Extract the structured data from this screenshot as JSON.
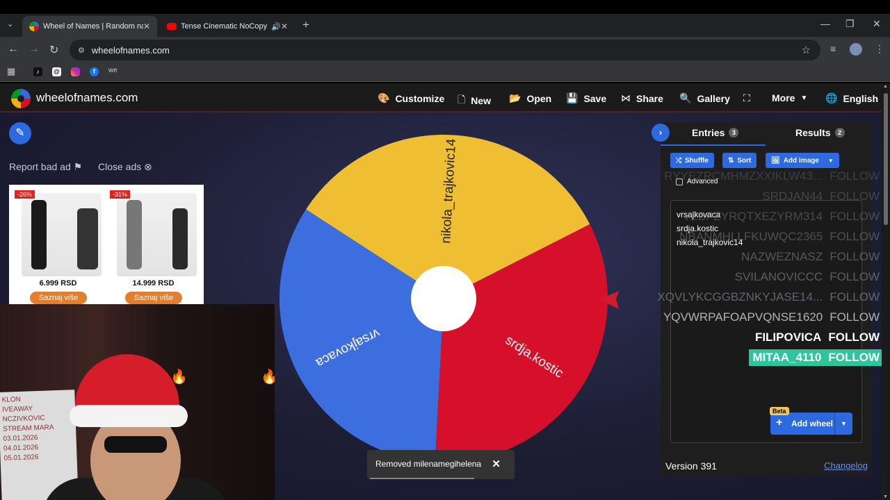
{
  "browser": {
    "tabs": [
      {
        "title": "Wheel of Names | Random nam",
        "active": true
      },
      {
        "title": "Tense Cinematic NoCopyrig",
        "active": false
      }
    ],
    "url": "wheelofnames.com",
    "bookmark_text": "we"
  },
  "site": {
    "name": "wheelofnames.com",
    "nav": {
      "customize": "Customize",
      "new": "New",
      "open": "Open",
      "save": "Save",
      "share": "Share",
      "gallery": "Gallery",
      "more": "More",
      "language": "English"
    }
  },
  "ads": {
    "report": "Report bad ad",
    "close": "Close ads",
    "products": [
      {
        "discount": "-26%",
        "price": "6.999 RSD",
        "cta": "Saznaj više"
      },
      {
        "discount": "-31%",
        "price": "14.999 RSD",
        "cta": "Saznaj više"
      }
    ]
  },
  "webcam": {
    "whiteboard_lines": [
      "KLON",
      "IVEAWAY",
      "NCZIVKOVIC",
      "STREAM MARA",
      "03.01.2026",
      "04.01.2026",
      "05.01.2026"
    ]
  },
  "wheel": {
    "segments": [
      {
        "label": "nikola_trajkovic14",
        "color": "#efbe32"
      },
      {
        "label": "srdja.kostic",
        "color": "#d6102b"
      },
      {
        "label": "vrsajkovaca",
        "color": "#3d6ee0"
      }
    ]
  },
  "toast": {
    "message": "Removed milenamegihelena"
  },
  "panel": {
    "entries_tab": "Entries",
    "entries_count": "3",
    "results_tab": "Results",
    "results_count": "2",
    "shuffle": "Shuffle",
    "sort": "Sort",
    "add_image": "Add image",
    "advanced": "Advanced",
    "entries": [
      "vrsajkovaca",
      "srdja.kostic",
      "nikola_trajkovic14"
    ],
    "beta": "Beta",
    "add_wheel": "Add wheel",
    "version": "Version 391",
    "changelog": "Changelog"
  },
  "follows_overlay": [
    {
      "name": "RYYEZRCMHMZXXIKLW43...",
      "action": "FOLLOW"
    },
    {
      "name": "SRDJAN44",
      "action": "FOLLOW"
    },
    {
      "name": "YZBPZYRQTXEZYRM314",
      "action": "FOLLOW"
    },
    {
      "name": "NBANMHLLFKUWQC2365",
      "action": "FOLLOW"
    },
    {
      "name": "NAZWEZNASZ",
      "action": "FOLLOW"
    },
    {
      "name": "SVILANOVICCC",
      "action": "FOLLOW"
    },
    {
      "name": "XQVLYKCGGBZNKYJASE14...",
      "action": "FOLLOW"
    },
    {
      "name": "YQVWRPAFOAPVQNSE1620",
      "action": "FOLLOW"
    },
    {
      "name": "FILIPOVICA",
      "action": "FOLLOW"
    },
    {
      "name": "MITAA_4110",
      "action": "FOLLOW"
    }
  ]
}
